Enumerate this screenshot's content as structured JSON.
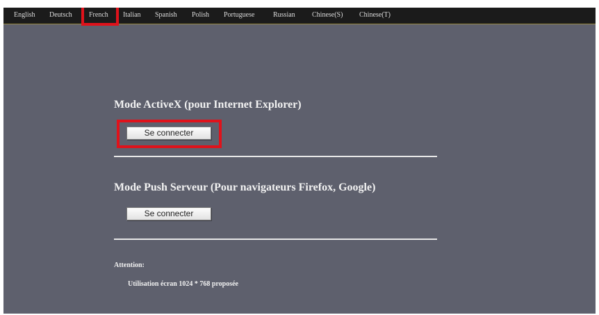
{
  "language_bar": {
    "items": [
      "English",
      "Deutsch",
      "French",
      "Italian",
      "Spanish",
      "Polish",
      "Portuguese",
      "Russian",
      "Chinese(S)",
      "Chinese(T)"
    ],
    "selected": "French",
    "highlight_color": "#e0121b"
  },
  "activex": {
    "title": "Mode ActiveX (pour Internet Explorer)",
    "button_label": "Se connecter"
  },
  "push": {
    "title": "Mode Push Serveur (Pour navigateurs Firefox, Google)",
    "button_label": "Se connecter"
  },
  "attention": {
    "label": "Attention:",
    "text": "Utilisation écran 1024 * 768 proposée"
  },
  "colors": {
    "background": "#5e606d",
    "top_bar": "#1b1b1b",
    "annotation": "#e0121b"
  }
}
